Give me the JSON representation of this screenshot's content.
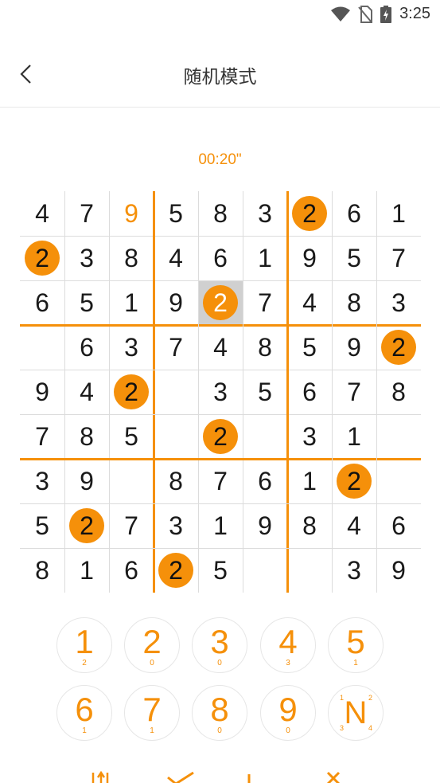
{
  "status": {
    "time": "3:25"
  },
  "header": {
    "title": "随机模式"
  },
  "timer": "00:20\"",
  "board": {
    "givens": [
      "479583261",
      "038461957",
      "651907483",
      "063748590",
      "940035678",
      "785090310",
      "390876100",
      "507319846",
      "816050039"
    ],
    "user_cells": [
      [
        0,
        2
      ]
    ],
    "marked_cells": [
      [
        0,
        6
      ],
      [
        1,
        0
      ],
      [
        2,
        4
      ],
      [
        3,
        8
      ],
      [
        4,
        2
      ],
      [
        5,
        4
      ],
      [
        6,
        7
      ],
      [
        7,
        1
      ],
      [
        8,
        3
      ]
    ],
    "marked_value": "2",
    "selected_cell": [
      2,
      4
    ]
  },
  "numpad": {
    "keys": [
      {
        "label": "1",
        "count": "2"
      },
      {
        "label": "2",
        "count": "0"
      },
      {
        "label": "3",
        "count": "0"
      },
      {
        "label": "4",
        "count": "3"
      },
      {
        "label": "5",
        "count": "1"
      },
      {
        "label": "6",
        "count": "1"
      },
      {
        "label": "7",
        "count": "1"
      },
      {
        "label": "8",
        "count": "0"
      },
      {
        "label": "9",
        "count": "0"
      }
    ],
    "note_key": {
      "label": "N",
      "corners": [
        "1",
        "2",
        "3",
        "4"
      ]
    }
  },
  "colors": {
    "accent": "#f5900a",
    "selected": "#d0d0d0",
    "grid": "#dcdcdc"
  }
}
